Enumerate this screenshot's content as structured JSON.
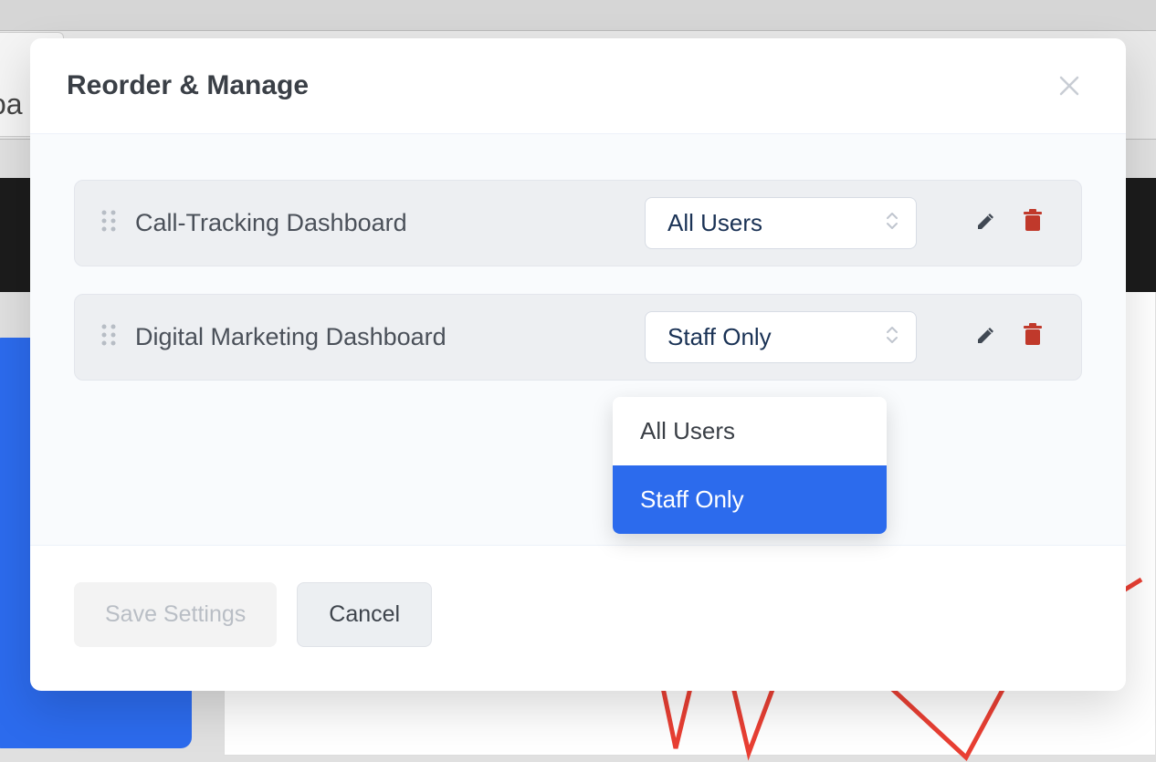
{
  "background": {
    "tab_text": "oa"
  },
  "modal": {
    "title": "Reorder & Manage",
    "items": [
      {
        "label": "Call-Tracking Dashboard",
        "select_value": "All Users"
      },
      {
        "label": "Digital Marketing Dashboard",
        "select_value": "Staff Only"
      }
    ],
    "dropdown": {
      "options": [
        "All Users",
        "Staff Only"
      ],
      "selected": "Staff Only"
    },
    "footer": {
      "save_label": "Save Settings",
      "cancel_label": "Cancel"
    }
  }
}
